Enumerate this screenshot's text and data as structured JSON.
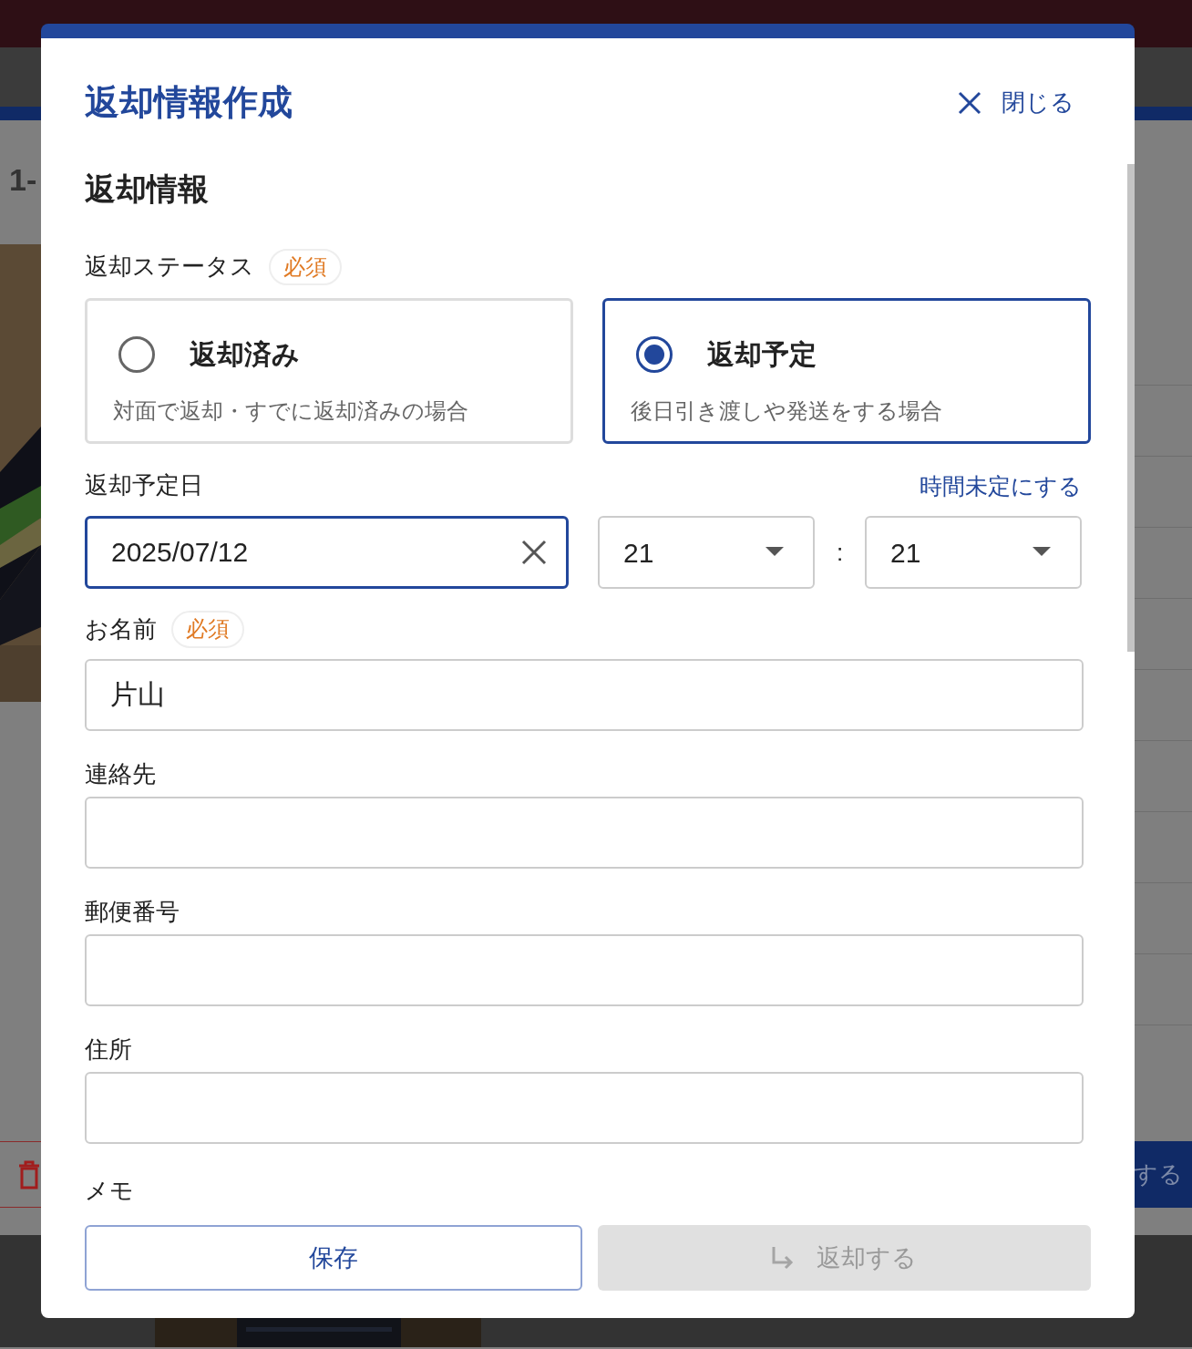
{
  "background": {
    "heading": "1-",
    "action_button": "する"
  },
  "modal": {
    "title": "返却情報作成",
    "close_label": "閉じる",
    "section": "返却情報",
    "status": {
      "label": "返却ステータス",
      "required": "必須",
      "options": [
        {
          "title": "返却済み",
          "description": "対面で返却・すでに返却済みの場合",
          "selected": false
        },
        {
          "title": "返却予定",
          "description": "後日引き渡しや発送をする場合",
          "selected": true
        }
      ]
    },
    "date": {
      "label": "返却予定日",
      "link": "時間未定にする",
      "value": "2025/07/12",
      "hour": "21",
      "separator": ":",
      "minute": "21"
    },
    "fields": [
      {
        "label": "お名前",
        "required": "必須",
        "value": "片山"
      },
      {
        "label": "連絡先"
      },
      {
        "label": "郵便番号"
      },
      {
        "label": "住所"
      }
    ],
    "memo_label": "メモ",
    "buttons": [
      {
        "label": "保存",
        "disabled": false,
        "kind": "save"
      },
      {
        "label": "返却する",
        "disabled": true,
        "kind": "return"
      }
    ]
  }
}
